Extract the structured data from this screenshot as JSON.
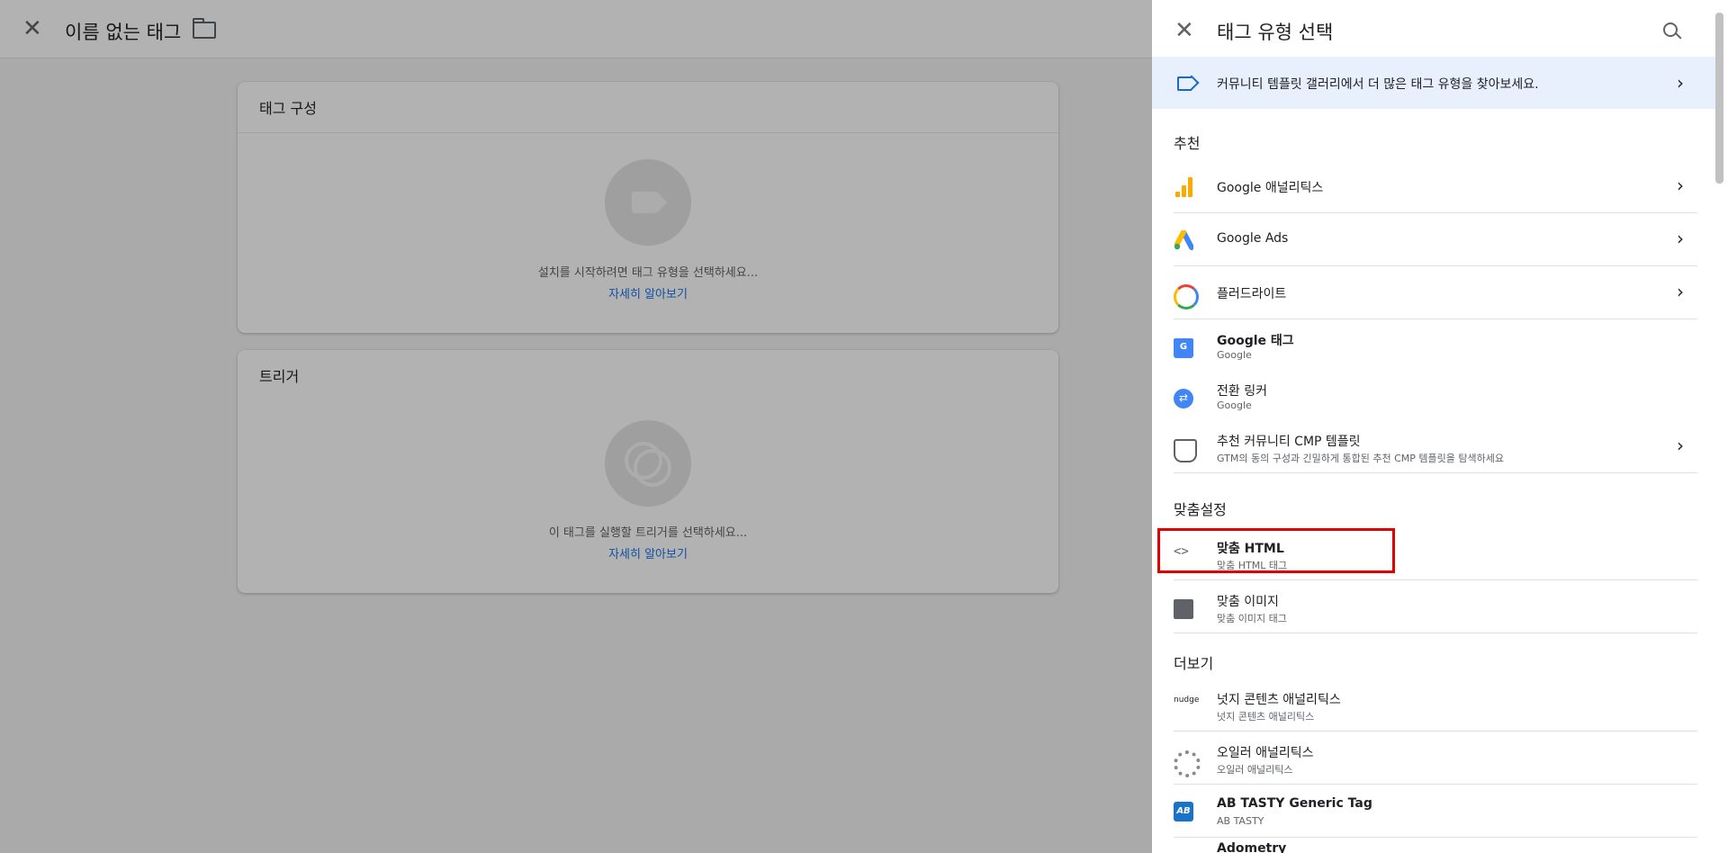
{
  "editor": {
    "tag_name": "이름 없는 태그",
    "tag_config": {
      "title": "태그 구성",
      "hint": "설치를 시작하려면 태그 유형을 선택하세요...",
      "learn_more": "자세히 알아보기"
    },
    "triggers": {
      "title": "트리거",
      "hint": "이 태그를 실행할 트리거를 선택하세요...",
      "learn_more": "자세히 알아보기"
    }
  },
  "panel": {
    "title": "태그 유형 선택",
    "banner": "커뮤니티 템플릿 갤러리에서 더 많은 태그 유형을 찾아보세요.",
    "sections": {
      "featured": "추천",
      "custom": "맞춤설정",
      "more": "더보기"
    },
    "featured_items": [
      {
        "name": "Google 애널리틱스",
        "icon": "google-analytics-icon"
      },
      {
        "name": "Google Ads",
        "icon": "google-ads-icon"
      },
      {
        "name": "플러드라이트",
        "icon": "floodlight-icon"
      },
      {
        "name": "Google 태그",
        "sub": "Google",
        "icon": "google-tag-icon"
      },
      {
        "name": "전환 링커",
        "sub": "Google",
        "icon": "conversion-linker-icon"
      },
      {
        "name": "추천 커뮤니티 CMP 템플릿",
        "sub": "GTM의 동의 구성과 긴밀하게 통합된 추천 CMP 템플릿을 탐색하세요",
        "icon": "shield-check-icon"
      }
    ],
    "custom_items": [
      {
        "name": "맞춤 HTML",
        "sub": "맞춤 HTML 태그",
        "icon": "code-icon"
      },
      {
        "name": "맞춤 이미지",
        "sub": "맞춤 이미지 태그",
        "icon": "image-icon"
      }
    ],
    "more_items": [
      {
        "name": "넛지 콘텐츠 애널리틱스",
        "sub": "넛지 콘텐츠 애널리틱스",
        "logo_text": "nudge"
      },
      {
        "name": "오일러 애널리틱스",
        "sub": "오일러 애널리틱스"
      },
      {
        "name": "AB TASTY Generic Tag",
        "sub": "AB TASTY",
        "logo_text": "AB"
      },
      {
        "name": "Adometry"
      }
    ]
  }
}
